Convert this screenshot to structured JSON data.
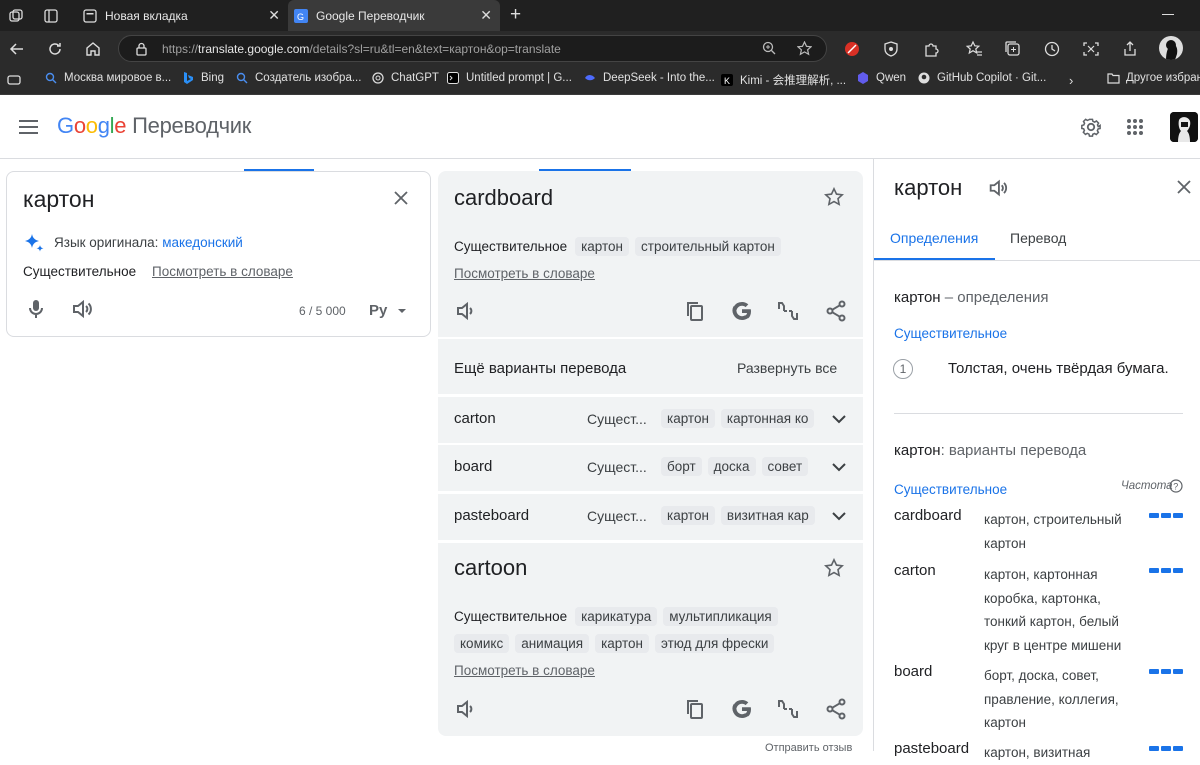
{
  "browser": {
    "tabs": [
      {
        "title": "Новая вкладка"
      },
      {
        "title": "Google Переводчик"
      }
    ],
    "url_prefix": "https://",
    "url_host": "translate.google.com",
    "url_rest": "/details?sl=ru&tl=en&text=картон&op=translate",
    "bookmarks": [
      "Москва мировое в...",
      "Bing",
      "Создатель изобра...",
      "ChatGPT",
      "Untitled prompt | G...",
      "DeepSeek - Into the...",
      "Kimi - 会推理解析, ...",
      "Qwen",
      "GitHub Copilot · Git..."
    ],
    "bookmarks_folder": "Другое избранн"
  },
  "header": {
    "logo_letters": [
      "G",
      "o",
      "o",
      "g",
      "l",
      "e"
    ],
    "logo_colors": [
      "#4285f4",
      "#ea4335",
      "#fbbc05",
      "#4285f4",
      "#34a853",
      "#ea4335"
    ],
    "product": "Переводчик"
  },
  "source": {
    "text": "картон",
    "detected_label": "Язык оригинала:",
    "detected_lang": "македонский",
    "pos": "Существительное",
    "dict_link": "Посмотреть в словаре",
    "char_count": "6 / 5 000",
    "keyboard_label": "Ру"
  },
  "target": {
    "main": "cardboard",
    "pos": "Существительное",
    "chips": [
      "картон",
      "строительный картон"
    ],
    "dict_link": "Посмотреть в словаре"
  },
  "more": {
    "title": "Ещё варианты перевода",
    "expand": "Развернуть все",
    "rows": [
      {
        "word": "carton",
        "pos": "Сущест...",
        "chips": [
          "картон",
          "картонная ко"
        ]
      },
      {
        "word": "board",
        "pos": "Сущест...",
        "chips": [
          "борт",
          "доска",
          "совет"
        ]
      },
      {
        "word": "pasteboard",
        "pos": "Сущест...",
        "chips": [
          "картон",
          "визитная кар"
        ]
      }
    ]
  },
  "second": {
    "main": "cartoon",
    "pos": "Существительное",
    "chips_row1": [
      "карикатура",
      "мультипликация"
    ],
    "chips_row2": [
      "комикс",
      "анимация",
      "картон",
      "этюд для фрески"
    ],
    "dict_link": "Посмотреть в словаре",
    "feedback": "Отправить отзыв"
  },
  "side": {
    "word": "картон",
    "tabs": [
      "Определения",
      "Перевод"
    ],
    "def_word": "картон",
    "def_suffix": " – определения",
    "def_pos": "Существительное",
    "def_num": "1",
    "def_text": "Толстая, очень твёрдая бумага.",
    "var_word": "картон",
    "var_suffix": ": варианты перевода",
    "var_pos": "Существительное",
    "freq_label": "Частота",
    "entries": [
      {
        "word": "cardboard",
        "lines": [
          "картон, строительный",
          "картон"
        ]
      },
      {
        "word": "carton",
        "lines": [
          "картон, картонная",
          "коробка, картонка,",
          "тонкий картон, белый",
          "круг в центре мишени"
        ]
      },
      {
        "word": "board",
        "lines": [
          "борт, доска, совет,",
          "правление, коллегия,",
          "картон"
        ]
      },
      {
        "word": "pasteboard",
        "lines": [
          "картон, визитная"
        ]
      }
    ]
  }
}
